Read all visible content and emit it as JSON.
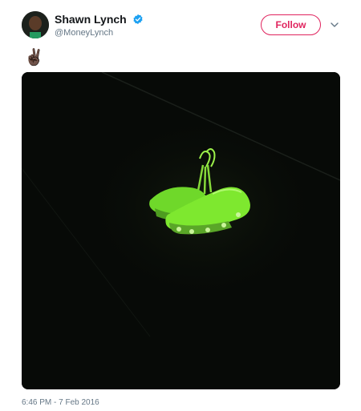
{
  "author": {
    "display_name": "Shawn Lynch",
    "handle": "@MoneyLynch",
    "verified": true
  },
  "follow_button_label": "Follow",
  "tweet_text": "✌🏿",
  "media": {
    "subject": "neon green cleats hanging from a wire at night"
  },
  "timestamp": "6:46 PM - 7 Feb 2016",
  "colors": {
    "follow_accent": "#e0245e",
    "verified_blue": "#1da1f2",
    "secondary_text": "#657786",
    "media_background": "#070a07",
    "cleat_green": "#7ee82f"
  },
  "icons": {
    "verified": "verified-badge-icon",
    "caret": "chevron-down-icon"
  }
}
